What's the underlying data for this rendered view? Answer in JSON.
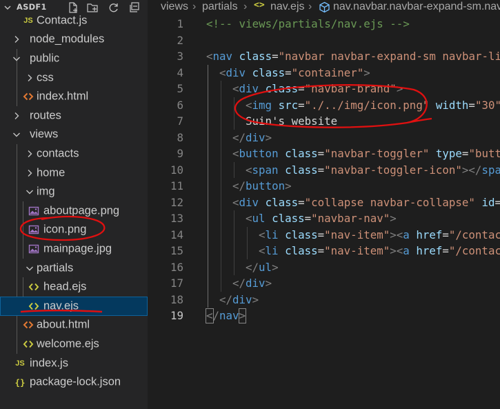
{
  "explorer": {
    "title": "ASDF1",
    "actions": [
      {
        "name": "new-file-icon"
      },
      {
        "name": "new-folder-icon"
      },
      {
        "name": "refresh-icon"
      },
      {
        "name": "collapse-all-icon"
      }
    ],
    "items": [
      {
        "label": "Contact.js",
        "kind": "js",
        "depth": 1,
        "icon": "js-file-icon"
      },
      {
        "label": "node_modules",
        "kind": "folder-closed",
        "depth": 0,
        "icon": "chevron-right-icon"
      },
      {
        "label": "public",
        "kind": "folder-open",
        "depth": 0,
        "icon": "chevron-down-icon"
      },
      {
        "label": "css",
        "kind": "folder-closed",
        "depth": 1,
        "icon": "chevron-right-icon"
      },
      {
        "label": "index.html",
        "kind": "html",
        "depth": 1,
        "icon": "html-file-icon"
      },
      {
        "label": "routes",
        "kind": "folder-closed",
        "depth": 0,
        "icon": "chevron-right-icon"
      },
      {
        "label": "views",
        "kind": "folder-open",
        "depth": 0,
        "icon": "chevron-down-icon"
      },
      {
        "label": "contacts",
        "kind": "folder-closed",
        "depth": 1,
        "icon": "chevron-right-icon"
      },
      {
        "label": "home",
        "kind": "folder-closed",
        "depth": 1,
        "icon": "chevron-right-icon"
      },
      {
        "label": "img",
        "kind": "folder-open",
        "depth": 1,
        "icon": "chevron-down-icon"
      },
      {
        "label": "aboutpage.png",
        "kind": "image",
        "depth": 2,
        "icon": "image-file-icon"
      },
      {
        "label": "icon.png",
        "kind": "image",
        "depth": 2,
        "icon": "image-file-icon"
      },
      {
        "label": "mainpage.jpg",
        "kind": "image",
        "depth": 2,
        "icon": "image-file-icon"
      },
      {
        "label": "partials",
        "kind": "folder-open",
        "depth": 1,
        "icon": "chevron-down-icon"
      },
      {
        "label": "head.ejs",
        "kind": "ejs",
        "depth": 2,
        "icon": "ejs-file-icon"
      },
      {
        "label": "nav.ejs",
        "kind": "ejs",
        "depth": 2,
        "icon": "ejs-file-icon",
        "selected": true
      },
      {
        "label": "about.html",
        "kind": "html",
        "depth": 1,
        "icon": "html-file-icon"
      },
      {
        "label": "welcome.ejs",
        "kind": "ejs",
        "depth": 1,
        "icon": "ejs-file-icon"
      },
      {
        "label": "index.js",
        "kind": "js",
        "depth": 0,
        "icon": "js-file-icon"
      },
      {
        "label": "package-lock.json",
        "kind": "json",
        "depth": 0,
        "icon": "json-file-icon"
      }
    ]
  },
  "breadcrumb": {
    "segments": [
      "views",
      "partials",
      "nav.ejs",
      "nav.navbar.navbar-expand-sm.navbar-light.bg-light"
    ],
    "separator": "›"
  },
  "editor": {
    "active_line": 19,
    "lines": [
      {
        "n": 1,
        "indent": 0,
        "tokens": [
          [
            "cmt",
            "<!-- views/partials/nav.ejs -->"
          ]
        ]
      },
      {
        "n": 2,
        "indent": 0,
        "tokens": []
      },
      {
        "n": 3,
        "indent": 0,
        "tokens": [
          [
            "br",
            "<"
          ],
          [
            "tag",
            "nav"
          ],
          [
            "txt",
            " "
          ],
          [
            "attr",
            "class"
          ],
          [
            "eq",
            "="
          ],
          [
            "str",
            "\"navbar navbar-expand-sm navbar-light bg-light\""
          ],
          [
            "br",
            ">"
          ]
        ]
      },
      {
        "n": 4,
        "indent": 1,
        "tokens": [
          [
            "br",
            "<"
          ],
          [
            "tag",
            "div"
          ],
          [
            "txt",
            " "
          ],
          [
            "attr",
            "class"
          ],
          [
            "eq",
            "="
          ],
          [
            "str",
            "\"container\""
          ],
          [
            "br",
            ">"
          ]
        ]
      },
      {
        "n": 5,
        "indent": 2,
        "tokens": [
          [
            "br",
            "<"
          ],
          [
            "tag",
            "div"
          ],
          [
            "txt",
            " "
          ],
          [
            "attr",
            "class"
          ],
          [
            "eq",
            "="
          ],
          [
            "str",
            "\"navbar-brand\""
          ],
          [
            "br",
            ">"
          ]
        ]
      },
      {
        "n": 6,
        "indent": 3,
        "tokens": [
          [
            "br",
            "<"
          ],
          [
            "tag",
            "img"
          ],
          [
            "txt",
            " "
          ],
          [
            "attr",
            "src"
          ],
          [
            "eq",
            "="
          ],
          [
            "str",
            "\"./../img/icon.png\""
          ],
          [
            "txt",
            " "
          ],
          [
            "attr",
            "width"
          ],
          [
            "eq",
            "="
          ],
          [
            "str",
            "\"30\""
          ],
          [
            "br",
            ">"
          ]
        ]
      },
      {
        "n": 7,
        "indent": 3,
        "tokens": [
          [
            "txt",
            "Suin's website"
          ]
        ]
      },
      {
        "n": 8,
        "indent": 2,
        "tokens": [
          [
            "br",
            "</"
          ],
          [
            "tag",
            "div"
          ],
          [
            "br",
            ">"
          ]
        ]
      },
      {
        "n": 9,
        "indent": 2,
        "tokens": [
          [
            "br",
            "<"
          ],
          [
            "tag",
            "button"
          ],
          [
            "txt",
            " "
          ],
          [
            "attr",
            "class"
          ],
          [
            "eq",
            "="
          ],
          [
            "str",
            "\"navbar-toggler\""
          ],
          [
            "txt",
            " "
          ],
          [
            "attr",
            "type"
          ],
          [
            "eq",
            "="
          ],
          [
            "str",
            "\"button\""
          ],
          [
            "br",
            ">"
          ]
        ]
      },
      {
        "n": 10,
        "indent": 3,
        "tokens": [
          [
            "br",
            "<"
          ],
          [
            "tag",
            "span"
          ],
          [
            "txt",
            " "
          ],
          [
            "attr",
            "class"
          ],
          [
            "eq",
            "="
          ],
          [
            "str",
            "\"navbar-toggler-icon\""
          ],
          [
            "br",
            "></"
          ],
          [
            "tag",
            "span"
          ],
          [
            "br",
            ">"
          ]
        ]
      },
      {
        "n": 11,
        "indent": 2,
        "tokens": [
          [
            "br",
            "</"
          ],
          [
            "tag",
            "button"
          ],
          [
            "br",
            ">"
          ]
        ]
      },
      {
        "n": 12,
        "indent": 2,
        "tokens": [
          [
            "br",
            "<"
          ],
          [
            "tag",
            "div"
          ],
          [
            "txt",
            " "
          ],
          [
            "attr",
            "class"
          ],
          [
            "eq",
            "="
          ],
          [
            "str",
            "\"collapse navbar-collapse\""
          ],
          [
            "txt",
            " "
          ],
          [
            "attr",
            "id"
          ],
          [
            "eq",
            "="
          ]
        ]
      },
      {
        "n": 13,
        "indent": 3,
        "tokens": [
          [
            "br",
            "<"
          ],
          [
            "tag",
            "ul"
          ],
          [
            "txt",
            " "
          ],
          [
            "attr",
            "class"
          ],
          [
            "eq",
            "="
          ],
          [
            "str",
            "\"navbar-nav\""
          ],
          [
            "br",
            ">"
          ]
        ]
      },
      {
        "n": 14,
        "indent": 4,
        "tokens": [
          [
            "br",
            "<"
          ],
          [
            "tag",
            "li"
          ],
          [
            "txt",
            " "
          ],
          [
            "attr",
            "class"
          ],
          [
            "eq",
            "="
          ],
          [
            "str",
            "\"nav-item\""
          ],
          [
            "br",
            "><"
          ],
          [
            "tag",
            "a"
          ],
          [
            "txt",
            " "
          ],
          [
            "attr",
            "href"
          ],
          [
            "eq",
            "="
          ],
          [
            "str",
            "\"/contacts\""
          ]
        ]
      },
      {
        "n": 15,
        "indent": 4,
        "tokens": [
          [
            "br",
            "<"
          ],
          [
            "tag",
            "li"
          ],
          [
            "txt",
            " "
          ],
          [
            "attr",
            "class"
          ],
          [
            "eq",
            "="
          ],
          [
            "str",
            "\"nav-item\""
          ],
          [
            "br",
            "><"
          ],
          [
            "tag",
            "a"
          ],
          [
            "txt",
            " "
          ],
          [
            "attr",
            "href"
          ],
          [
            "eq",
            "="
          ],
          [
            "str",
            "\"/contacts\""
          ]
        ]
      },
      {
        "n": 16,
        "indent": 3,
        "tokens": [
          [
            "br",
            "</"
          ],
          [
            "tag",
            "ul"
          ],
          [
            "br",
            ">"
          ]
        ]
      },
      {
        "n": 17,
        "indent": 2,
        "tokens": [
          [
            "br",
            "</"
          ],
          [
            "tag",
            "div"
          ],
          [
            "br",
            ">"
          ]
        ]
      },
      {
        "n": 18,
        "indent": 1,
        "tokens": [
          [
            "br",
            "</"
          ],
          [
            "tag",
            "div"
          ],
          [
            "br",
            ">"
          ]
        ]
      },
      {
        "n": 19,
        "indent": 0,
        "tokens": [
          [
            "br",
            "</"
          ],
          [
            "tag",
            "nav"
          ],
          [
            "br",
            ">"
          ]
        ]
      }
    ]
  },
  "colors": {
    "sidebar_bg": "#252526",
    "editor_bg": "#1e1e1e",
    "selection_bg": "#04395e",
    "selection_border": "#0e639c",
    "annotation_red": "#e01010",
    "folder_chevron": "#c5c5c5",
    "html_icon": "#e37933",
    "ejs_icon": "#cbcb41",
    "image_icon": "#a074c4"
  }
}
